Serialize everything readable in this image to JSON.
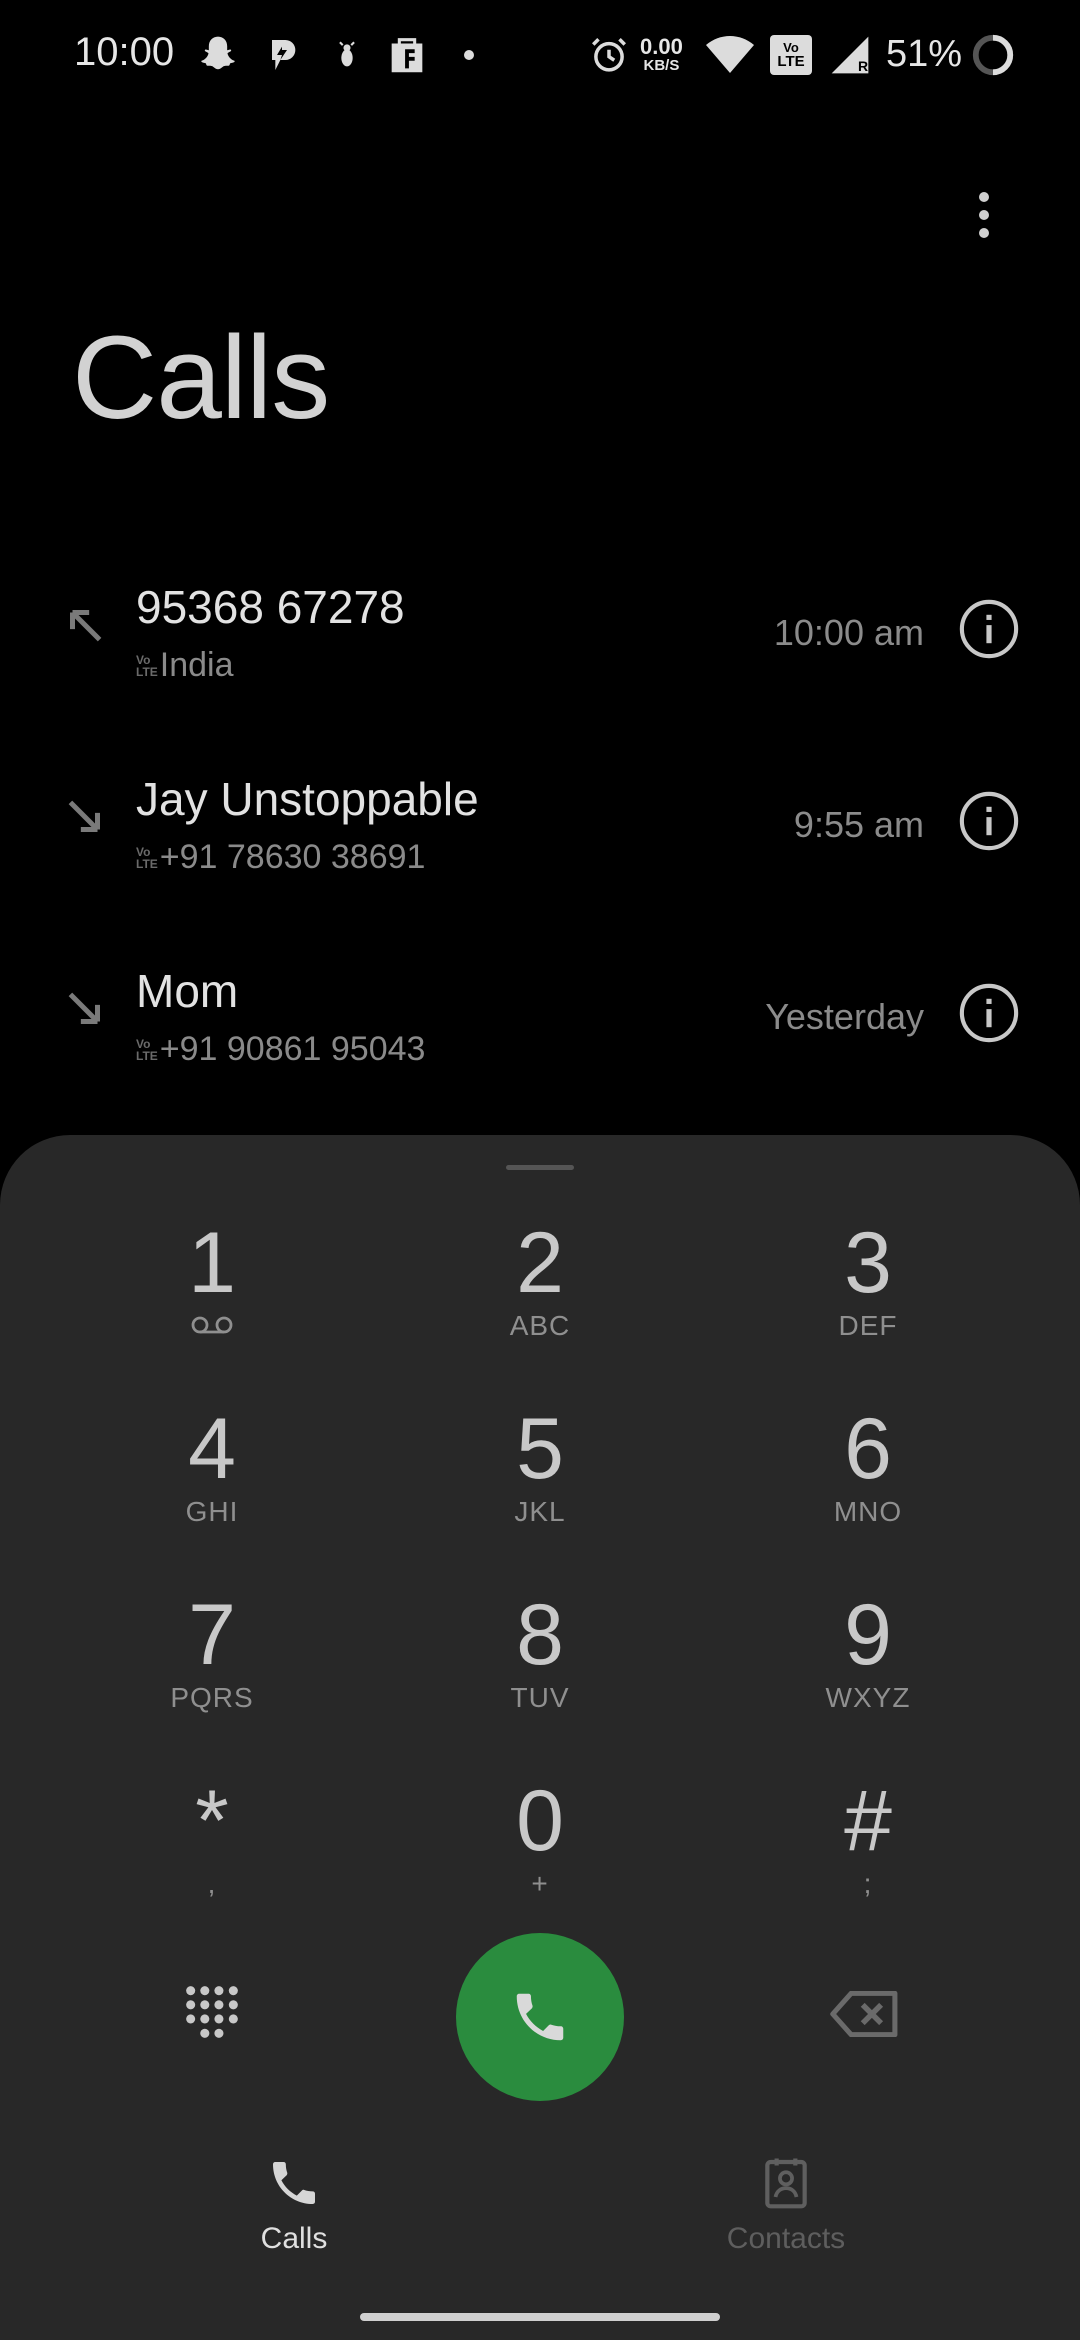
{
  "status_bar": {
    "time": "10:00",
    "net_speed_value": "0.00",
    "net_speed_unit": "KB/S",
    "volte_badge_top": "Vo",
    "volte_badge_bottom": "LTE",
    "roaming_indicator": "R",
    "battery": "51%",
    "icons": [
      "snapchat-icon",
      "notification-app-icon",
      "bug-icon",
      "shopping-bag-icon",
      "dot-icon",
      "alarm-icon",
      "wifi-icon",
      "volte-icon",
      "signal-icon",
      "battery-ring-icon"
    ]
  },
  "header": {
    "title": "Calls",
    "menu_icon": "more-vert-icon"
  },
  "calls": [
    {
      "name": "95368 67278",
      "subtitle": "India",
      "time": "10:00 am",
      "direction": "outgoing"
    },
    {
      "name": "Jay Unstoppable",
      "subtitle": "+91 78630 38691",
      "time": "9:55 am",
      "direction": "incoming"
    },
    {
      "name": "Mom",
      "subtitle": "+91 90861 95043",
      "time": "Yesterday",
      "direction": "incoming"
    }
  ],
  "volte_small": {
    "top": "Vo",
    "bottom": "LTE"
  },
  "dialpad": {
    "keys": [
      {
        "digit": "1",
        "letters": ""
      },
      {
        "digit": "2",
        "letters": "ABC"
      },
      {
        "digit": "3",
        "letters": "DEF"
      },
      {
        "digit": "4",
        "letters": "GHI"
      },
      {
        "digit": "5",
        "letters": "JKL"
      },
      {
        "digit": "6",
        "letters": "MNO"
      },
      {
        "digit": "7",
        "letters": "PQRS"
      },
      {
        "digit": "8",
        "letters": "TUV"
      },
      {
        "digit": "9",
        "letters": "WXYZ"
      },
      {
        "digit": "*",
        "letters": ","
      },
      {
        "digit": "0",
        "letters": "+"
      },
      {
        "digit": "#",
        "letters": ";"
      }
    ]
  },
  "bottom_nav": {
    "calls_label": "Calls",
    "contacts_label": "Contacts"
  },
  "colors": {
    "call_button": "#2a8c3e",
    "sheet_bg": "#282828",
    "background": "#000000"
  }
}
